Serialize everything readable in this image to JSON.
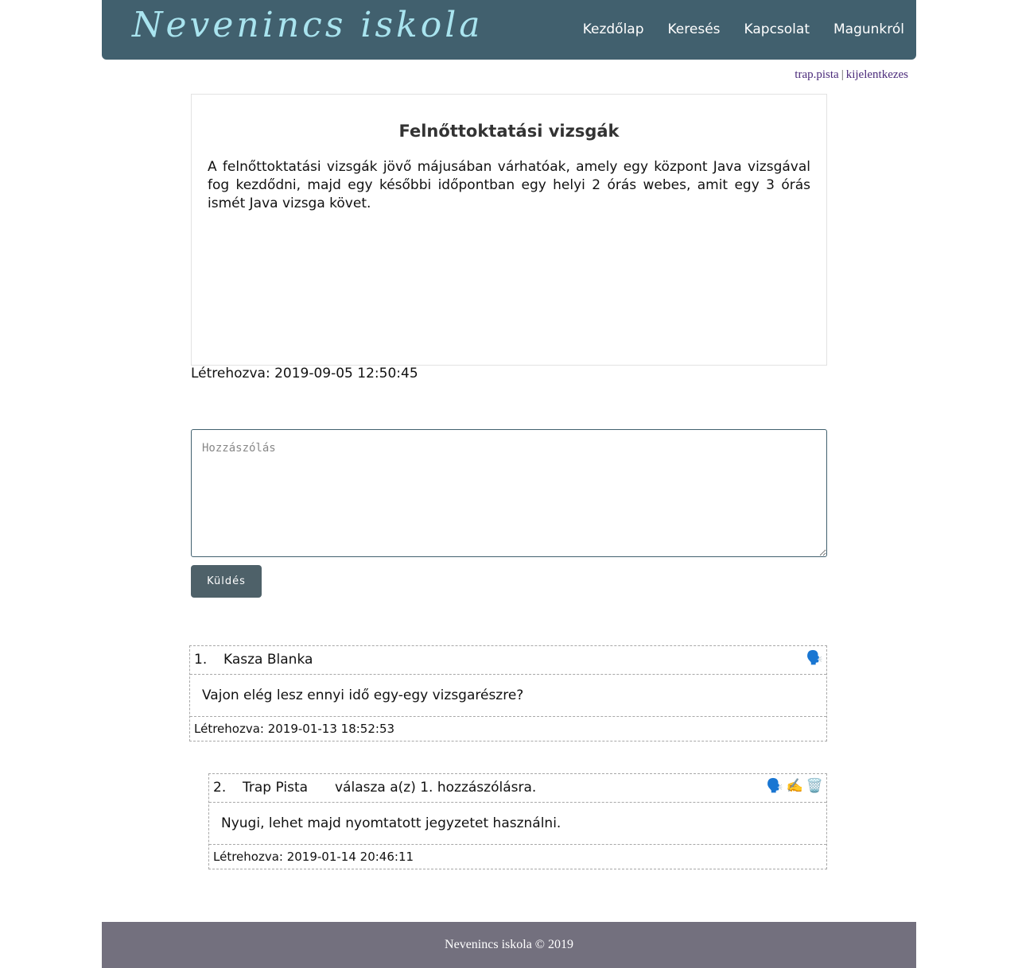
{
  "header": {
    "logo": "Nevenincs iskola",
    "nav": [
      "Kezdőlap",
      "Keresés",
      "Kapcsolat",
      "Magunkról"
    ]
  },
  "user": {
    "username": "trap.pista",
    "separator": "|",
    "logout": "kijelentkezes"
  },
  "article": {
    "title": "Felnőttoktatási vizsgák",
    "body": "A felnőttoktatási vizsgák jövő májusában várhatóak, amely egy központ Java vizsgával fog kezdődni, majd egy későbbi időpontban egy helyi 2 órás webes, amit egy 3 órás ismét Java vizsga követ.",
    "created": "Létrehozva: 2019-09-05 12:50:45"
  },
  "comment_form": {
    "placeholder": "Hozzászólás",
    "submit": "Küldés"
  },
  "comments": [
    {
      "number": "1.",
      "author": "Kasza Blanka",
      "reply_note": "",
      "text": "Vajon elég lesz ennyi idő egy-egy vizsgarészre?",
      "created": "Létrehozva: 2019-01-13 18:52:53",
      "icons": [
        "speaking-head-icon"
      ]
    },
    {
      "number": "2.",
      "author": "Trap Pista",
      "reply_note": "válasza a(z) 1. hozzászólásra.",
      "text": "Nyugi, lehet majd nyomtatott jegyzetet használni.",
      "created": "Létrehozva: 2019-01-14 20:46:11",
      "icons": [
        "speaking-head-icon",
        "writing-hand-icon",
        "wastebasket-icon"
      ]
    }
  ],
  "footer": {
    "text": "Nevenincs iskola © 2019"
  },
  "colors": {
    "header_bg": "#41606e",
    "logo": "#a9e4ef",
    "button_bg": "#4e6169",
    "footer_bg": "#73707e",
    "link": "#4a2a7a"
  }
}
